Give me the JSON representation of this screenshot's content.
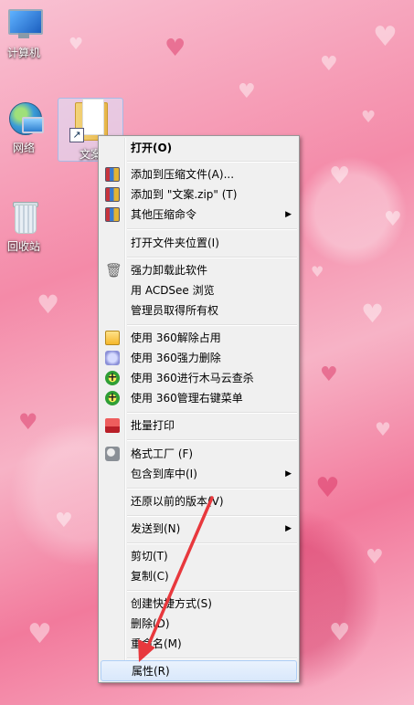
{
  "desktop": {
    "icons": [
      {
        "label": "计算机"
      },
      {
        "label": "网络"
      },
      {
        "label": "回收站"
      },
      {
        "label": "文案"
      }
    ]
  },
  "menu": {
    "items": {
      "open": "打开(O)",
      "add_archive": "添加到压缩文件(A)...",
      "add_zip": "添加到 \"文案.zip\" (T)",
      "other_compress": "其他压缩命令",
      "open_location": "打开文件夹位置(I)",
      "force_uninstall": "强力卸载此软件",
      "acdsee": "用 ACDSee 浏览",
      "take_ownership": "管理员取得所有权",
      "unlock_360": "使用 360解除占用",
      "force_delete_360": "使用 360强力删除",
      "trojan_scan_360": "使用 360进行木马云查杀",
      "menu_manager_360": "使用 360管理右键菜单",
      "batch_print": "批量打印",
      "format_factory": "格式工厂 (F)",
      "include_library": "包含到库中(I)",
      "restore_versions": "还原以前的版本(V)",
      "send_to": "发送到(N)",
      "cut": "剪切(T)",
      "copy": "复制(C)",
      "create_shortcut": "创建快捷方式(S)",
      "delete": "删除(D)",
      "rename": "重命名(M)",
      "properties": "属性(R)"
    },
    "submenu_arrow": "▶"
  },
  "colors": {
    "annotation_arrow": "#e8383d",
    "hover_bg": "#d9e8fb"
  }
}
